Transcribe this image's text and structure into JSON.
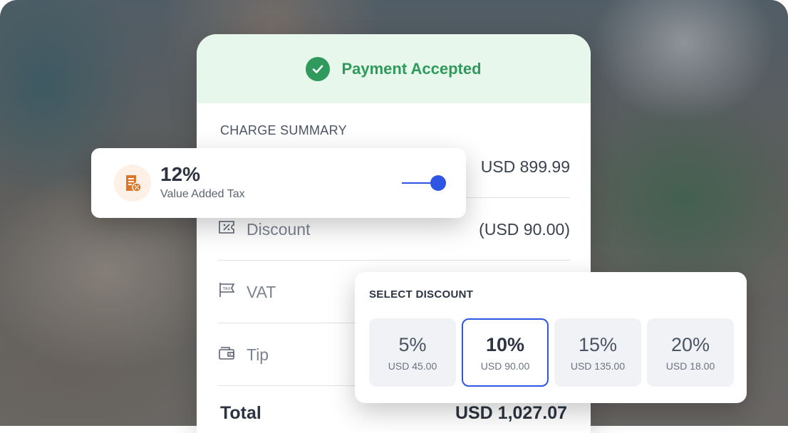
{
  "header": {
    "title": "Payment Accepted"
  },
  "summary": {
    "section_label": "CHARGE SUMMARY",
    "subtotal_value": "USD 899.99",
    "rows": [
      {
        "label": "Discount",
        "value": "(USD 90.00)"
      },
      {
        "label": "VAT",
        "value": ""
      },
      {
        "label": "Tip",
        "value": ""
      }
    ],
    "total_label": "Total",
    "total_value": "USD 1,027.07"
  },
  "tax_popup": {
    "percent": "12%",
    "label": "Value Added Tax",
    "toggle_on": true,
    "icon_badge": "%"
  },
  "discount_popup": {
    "title": "SELECT DISCOUNT",
    "options": [
      {
        "percent": "5%",
        "amount": "USD 45.00",
        "selected": false
      },
      {
        "percent": "10%",
        "amount": "USD 90.00",
        "selected": true
      },
      {
        "percent": "15%",
        "amount": "USD 135.00",
        "selected": false
      },
      {
        "percent": "20%",
        "amount": "USD 18.00",
        "selected": false
      }
    ]
  },
  "icons": {
    "discount": "discount-tag-icon",
    "vat": "tax-flag-icon",
    "tip": "wallet-icon",
    "tax": "invoice-percent-icon",
    "header": "check-circle-icon"
  },
  "colors": {
    "success": "#2f9a5c",
    "success_bg": "#e7f7ec",
    "accent": "#2f55e4",
    "tax_icon": "#d9782b"
  }
}
